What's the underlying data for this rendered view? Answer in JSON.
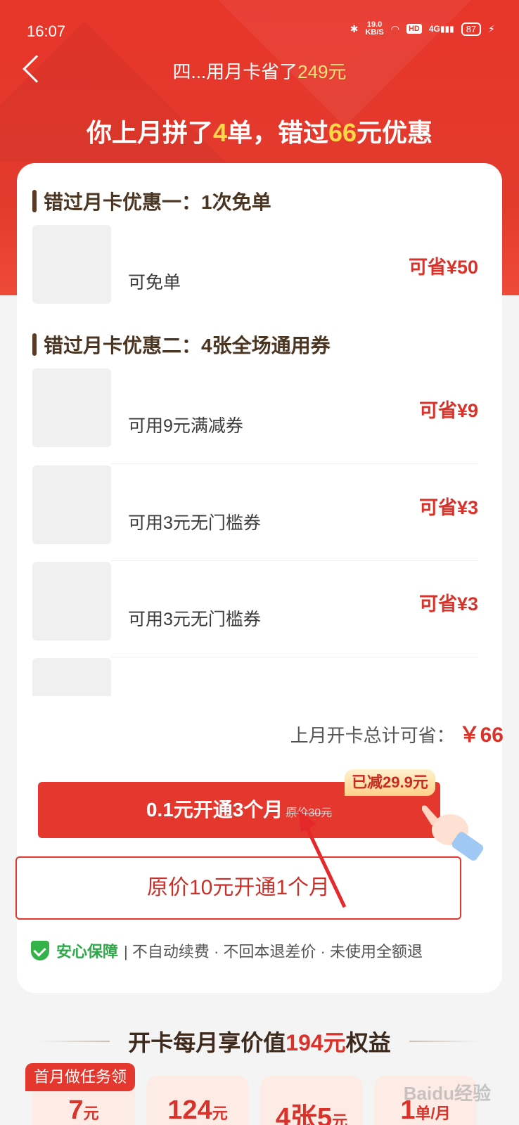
{
  "status_bar": {
    "time": "16:07",
    "net_speed_value": "19.0",
    "net_speed_unit": "KB/S",
    "hd": "HD",
    "signal": "4G",
    "battery": "87"
  },
  "nav": {
    "title_prefix": "四...用月卡省了",
    "title_amount": "249元"
  },
  "headline": {
    "part1": "你上月拼了",
    "orders": "4",
    "part2": "单，错过",
    "amount": "66",
    "part3": "元优惠"
  },
  "section1": {
    "title": "错过月卡优惠一：1次免单",
    "items": [
      {
        "desc": "可免单",
        "save": "可省¥50"
      }
    ]
  },
  "section2": {
    "title": "错过月卡优惠二：4张全场通用券",
    "items": [
      {
        "desc": "可用9元满减券",
        "save": "可省¥9"
      },
      {
        "desc": "可用3元无门槛券",
        "save": "可省¥3"
      },
      {
        "desc": "可用3元无门槛券",
        "save": "可省¥3"
      }
    ]
  },
  "total": {
    "label": "上月开卡总计可省：",
    "amount": "￥66"
  },
  "primary_button": {
    "label": "0.1元开通3个月",
    "original_price": "原价30元",
    "badge": "已减29.9元"
  },
  "secondary_button": {
    "label": "原价10元开通1个月"
  },
  "guarantee": {
    "title": "安心保障",
    "text": "| 不自动续费 · 不回本退差价 · 未使用全额退"
  },
  "benefits": {
    "title_prefix": "开卡每月享价值",
    "title_amount": "194元",
    "title_suffix": "权益",
    "tag": "首月做任务领",
    "tiles": [
      {
        "big": "7",
        "unit": "元"
      },
      {
        "big": "124",
        "unit": "元"
      },
      {
        "big": "4张5",
        "unit": "元"
      },
      {
        "big": "1",
        "unit": "单/月"
      }
    ]
  },
  "watermark": "Baidu经验"
}
